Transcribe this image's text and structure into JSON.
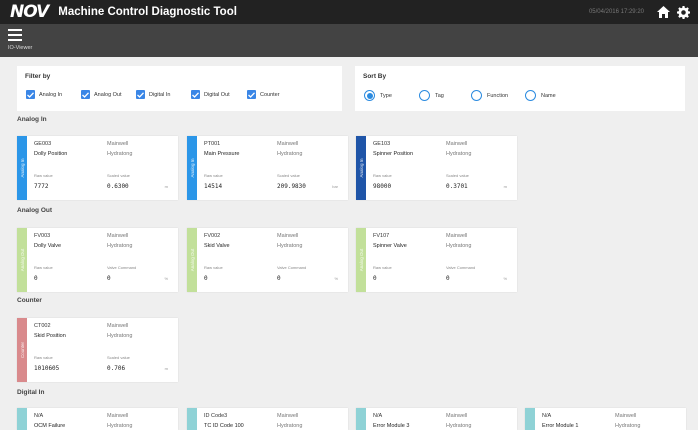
{
  "header": {
    "logo": "NOV",
    "title": "Machine Control Diagnostic Tool",
    "datetime": "05/04/2016  17:29:20",
    "home_icon": "home-icon",
    "settings_icon": "gear-icon"
  },
  "subheader": {
    "menu_icon": "hamburger-menu-icon",
    "title": "IO-Viewer"
  },
  "filter": {
    "title": "Filter by",
    "options": [
      {
        "label": "Analog In",
        "checked": true
      },
      {
        "label": "Analog Out",
        "checked": true
      },
      {
        "label": "Digital In",
        "checked": true
      },
      {
        "label": "Digital Out",
        "checked": true
      },
      {
        "label": "Counter",
        "checked": true
      }
    ]
  },
  "sort": {
    "title": "Sort By",
    "options": [
      {
        "label": "Type",
        "selected": true
      },
      {
        "label": "Tag",
        "selected": false
      },
      {
        "label": "Function",
        "selected": false
      },
      {
        "label": "Name",
        "selected": false
      }
    ]
  },
  "colors": {
    "analog_in": "#2b96e8",
    "analog_in_dark": "#1f55a8",
    "analog_out": "#c2e09a",
    "counter": "#d98a8c",
    "digital_in": "#8fd2d6",
    "accent": "#3a86e6"
  },
  "sections": {
    "analog_in": {
      "title": "Analog In",
      "cards": [
        {
          "type_label": "Analog In",
          "tag": "GE003",
          "location": "Mainwell",
          "function": "Dolly Position",
          "system": "Hydratong",
          "raw_label": "Raw value",
          "scaled_label": "Scaled value",
          "raw": "7772",
          "scaled": "0.6300",
          "unit": "m"
        },
        {
          "type_label": "Analog In",
          "tag": "PT001",
          "location": "Mainwell",
          "function": "Main Pressure",
          "system": "Hydratong",
          "raw_label": "Raw value",
          "scaled_label": "Scaled value",
          "raw": "14514",
          "scaled": "209.9830",
          "unit": "bar"
        },
        {
          "type_label": "Analog In",
          "tag": "GE103",
          "location": "Mainwell",
          "function": "Spinner Position",
          "system": "Hydratong",
          "raw_label": "Raw value",
          "scaled_label": "Scaled value",
          "raw": "98000",
          "scaled": "0.3701",
          "unit": "m"
        }
      ]
    },
    "analog_out": {
      "title": "Analog Out",
      "cards": [
        {
          "type_label": "Analog Out",
          "tag": "FV003",
          "location": "Mainwell",
          "function": "Dolly Valve",
          "system": "Hydratong",
          "raw_label": "Raw value",
          "scaled_label": "Valve Command",
          "raw": "0",
          "scaled": "0",
          "unit": "%"
        },
        {
          "type_label": "Analog Out",
          "tag": "FV002",
          "location": "Mainwell",
          "function": "Skid Valve",
          "system": "Hydratong",
          "raw_label": "Raw value",
          "scaled_label": "Valve Command",
          "raw": "0",
          "scaled": "0",
          "unit": "%"
        },
        {
          "type_label": "Analog Out",
          "tag": "FV107",
          "location": "Mainwell",
          "function": "Spinner Valve",
          "system": "Hydratong",
          "raw_label": "Raw value",
          "scaled_label": "Valve Command",
          "raw": "0",
          "scaled": "0",
          "unit": "%"
        }
      ]
    },
    "counter": {
      "title": "Counter",
      "cards": [
        {
          "type_label": "Counter",
          "tag": "CT002",
          "location": "Mainwell",
          "function": "Skid Position",
          "system": "Hydratong",
          "raw_label": "Raw value",
          "scaled_label": "Scaled value",
          "raw": "1010605",
          "scaled": "0.706",
          "unit": "m"
        }
      ]
    },
    "digital_in": {
      "title": "Digital In",
      "cards": [
        {
          "tag": "N/A",
          "location": "Mainwell",
          "function": "OCM Failure",
          "system": "Hydratong"
        },
        {
          "tag": "ID Code3",
          "location": "Mainwell",
          "function": "TC ID Code 100",
          "system": "Hydratong"
        },
        {
          "tag": "N/A",
          "location": "Mainwell",
          "function": "Error Module 3",
          "system": "Hydratong"
        },
        {
          "tag": "N/A",
          "location": "Mainwell",
          "function": "Error Module 1",
          "system": "Hydratong"
        }
      ]
    }
  }
}
